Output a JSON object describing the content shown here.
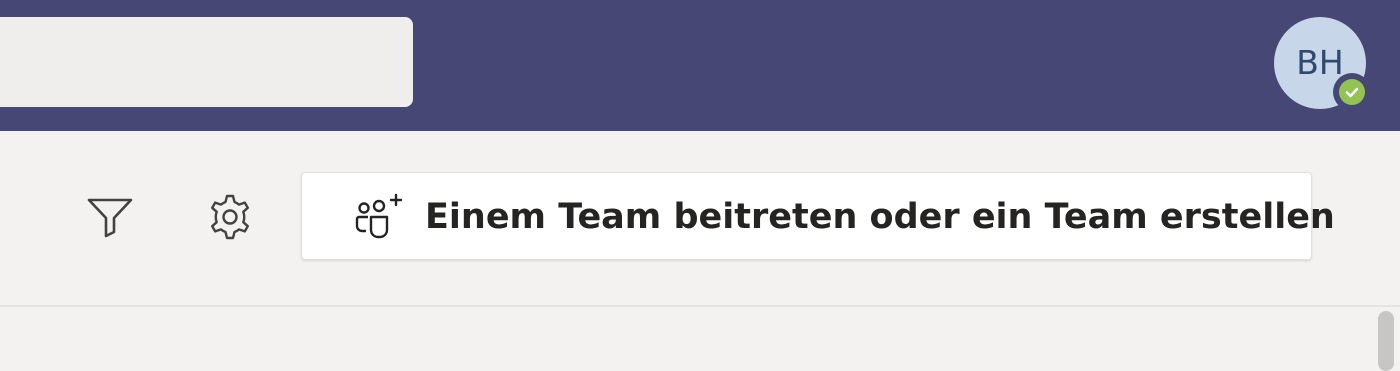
{
  "header": {
    "search": {
      "value": "",
      "placeholder": ""
    },
    "avatar": {
      "initials": "BH",
      "status": "available",
      "status_color": "#92c353"
    },
    "colors": {
      "bar": "#464775"
    }
  },
  "toolbar": {
    "filter_icon": "filter-icon",
    "settings_icon": "gear-icon",
    "join_button": {
      "icon": "people-add-icon",
      "label": "Einem Team beitreten oder ein Team erstellen"
    }
  }
}
